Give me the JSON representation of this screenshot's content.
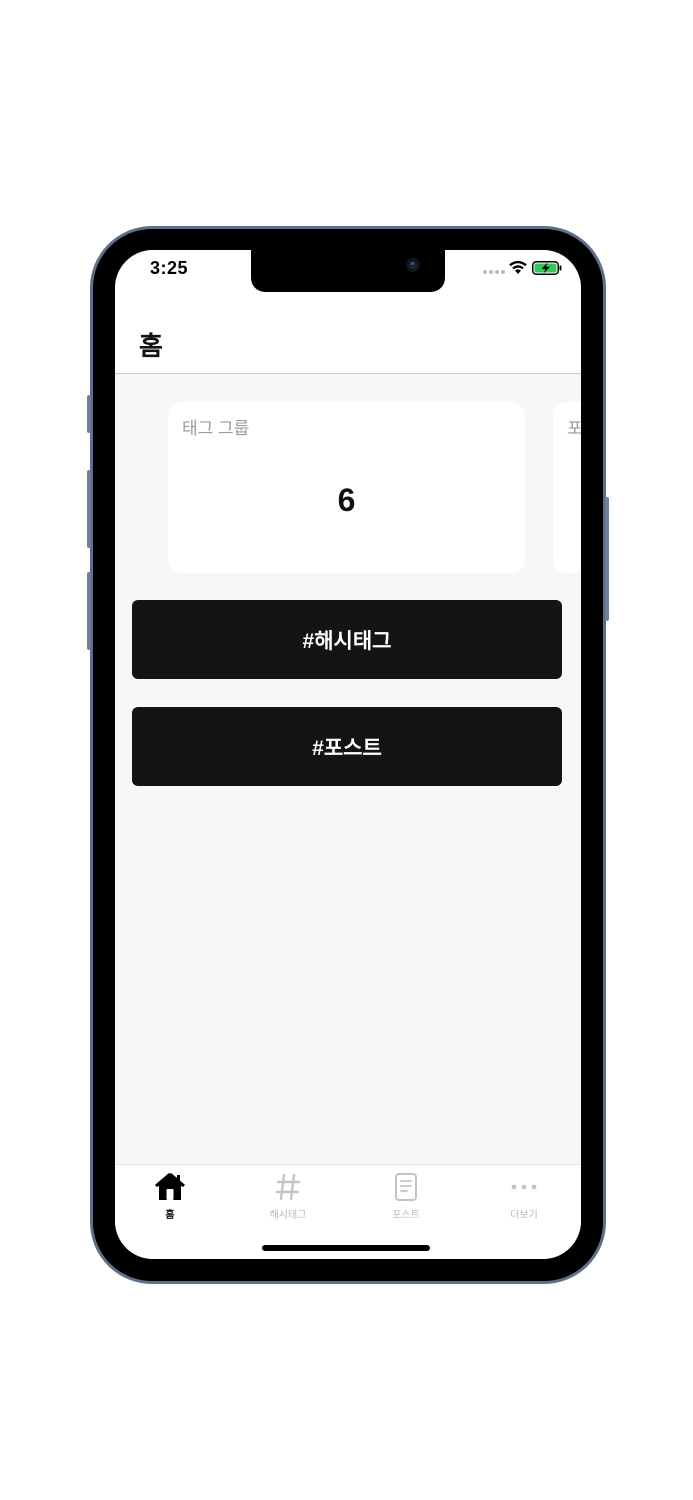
{
  "status_bar": {
    "time": "3:25"
  },
  "header": {
    "title": "홈"
  },
  "stat_cards": [
    {
      "label": "태그 그룹",
      "value": "6"
    },
    {
      "label": "포"
    }
  ],
  "actions": {
    "hashtag_label": "#해시태그",
    "post_label": "#포스트"
  },
  "tab_bar": {
    "items": [
      {
        "label": "홈",
        "icon": "home-icon",
        "active": true
      },
      {
        "label": "해시태그",
        "icon": "hashtag-icon",
        "active": false
      },
      {
        "label": "포스트",
        "icon": "document-icon",
        "active": false
      },
      {
        "label": "더보기",
        "icon": "more-icon",
        "active": false
      }
    ]
  },
  "colors": {
    "button_bg": "#141414",
    "screen_bg": "#f7f7f7",
    "frame_accent": "#5d6f8a",
    "battery_green": "#34c759"
  }
}
